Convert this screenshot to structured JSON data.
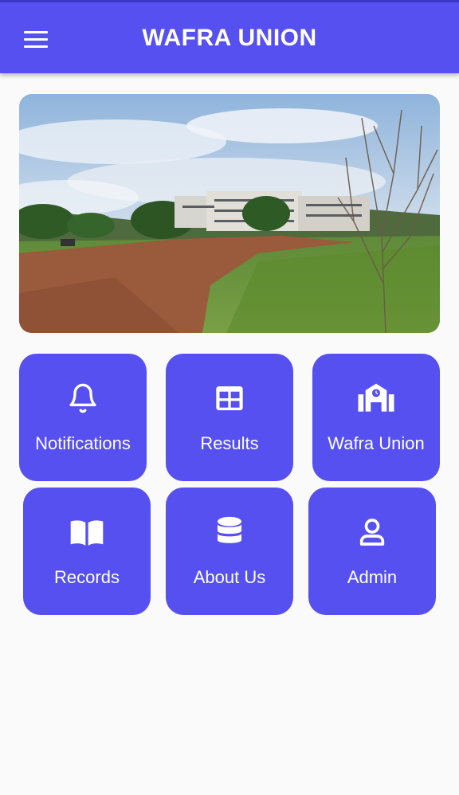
{
  "app_bar": {
    "title": "WAFRA UNION",
    "menu_icon": "hamburger-menu-icon"
  },
  "hero": {
    "image": "campus-building-photo"
  },
  "tiles": [
    {
      "label": "Notifications",
      "icon": "bell-icon"
    },
    {
      "label": "Results",
      "icon": "table-grid-icon"
    },
    {
      "label": "Wafra Union",
      "icon": "school-building-icon"
    },
    {
      "label": "Records",
      "icon": "open-book-icon"
    },
    {
      "label": "About Us",
      "icon": "database-icon"
    },
    {
      "label": "Admin",
      "icon": "person-icon"
    }
  ],
  "colors": {
    "primary": "#5650f0",
    "background": "#fafafa",
    "text_on_primary": "#ffffff"
  }
}
